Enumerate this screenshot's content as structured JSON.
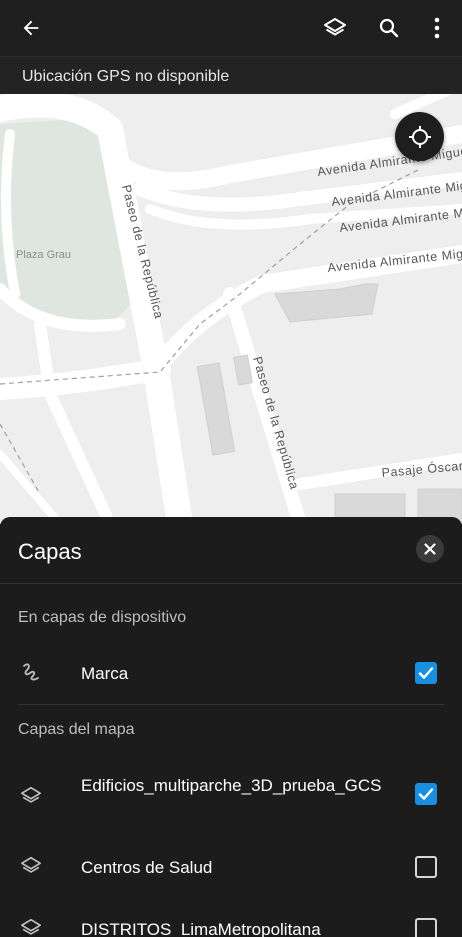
{
  "appbar": {
    "icons": [
      "arrow-left-icon",
      "layers-icon",
      "search-icon",
      "more-vert-icon"
    ]
  },
  "status": {
    "gps_text": "Ubicación GPS no disponible"
  },
  "map": {
    "labels": {
      "avenida_1": "Avenida Almirante Migue",
      "avenida_2": "Avenida Almirante Migue",
      "avenida_3": "Avenida Almirante Migu",
      "avenida_4": "Avenida Almirante Migu",
      "paseo_1": "Paseo de la República",
      "paseo_2": "Paseo de la República",
      "plaza": "Plaza Grau",
      "pasaje": "Pasaje Óscar A"
    }
  },
  "sheet": {
    "title": "Capas",
    "section_device": "En capas de dispositivo",
    "section_map": "Capas del mapa",
    "layers_device": [
      {
        "label": "Marca",
        "checked": true,
        "icon": "squiggle-icon"
      }
    ],
    "layers_map": [
      {
        "label": "Edificios_multiparche_3D_prueba_GCS",
        "checked": true,
        "icon": "layers-icon"
      },
      {
        "label": "Centros de Salud",
        "checked": false,
        "icon": "layers-icon"
      },
      {
        "label": "DISTRITOS_LimaMetropolitana",
        "checked": false,
        "icon": "layers-icon"
      }
    ]
  },
  "colors": {
    "accent": "#1a8fe0",
    "appbar": "#1f1f1f",
    "sheet": "#1c1c1c",
    "map_bg": "#eeeeee"
  }
}
